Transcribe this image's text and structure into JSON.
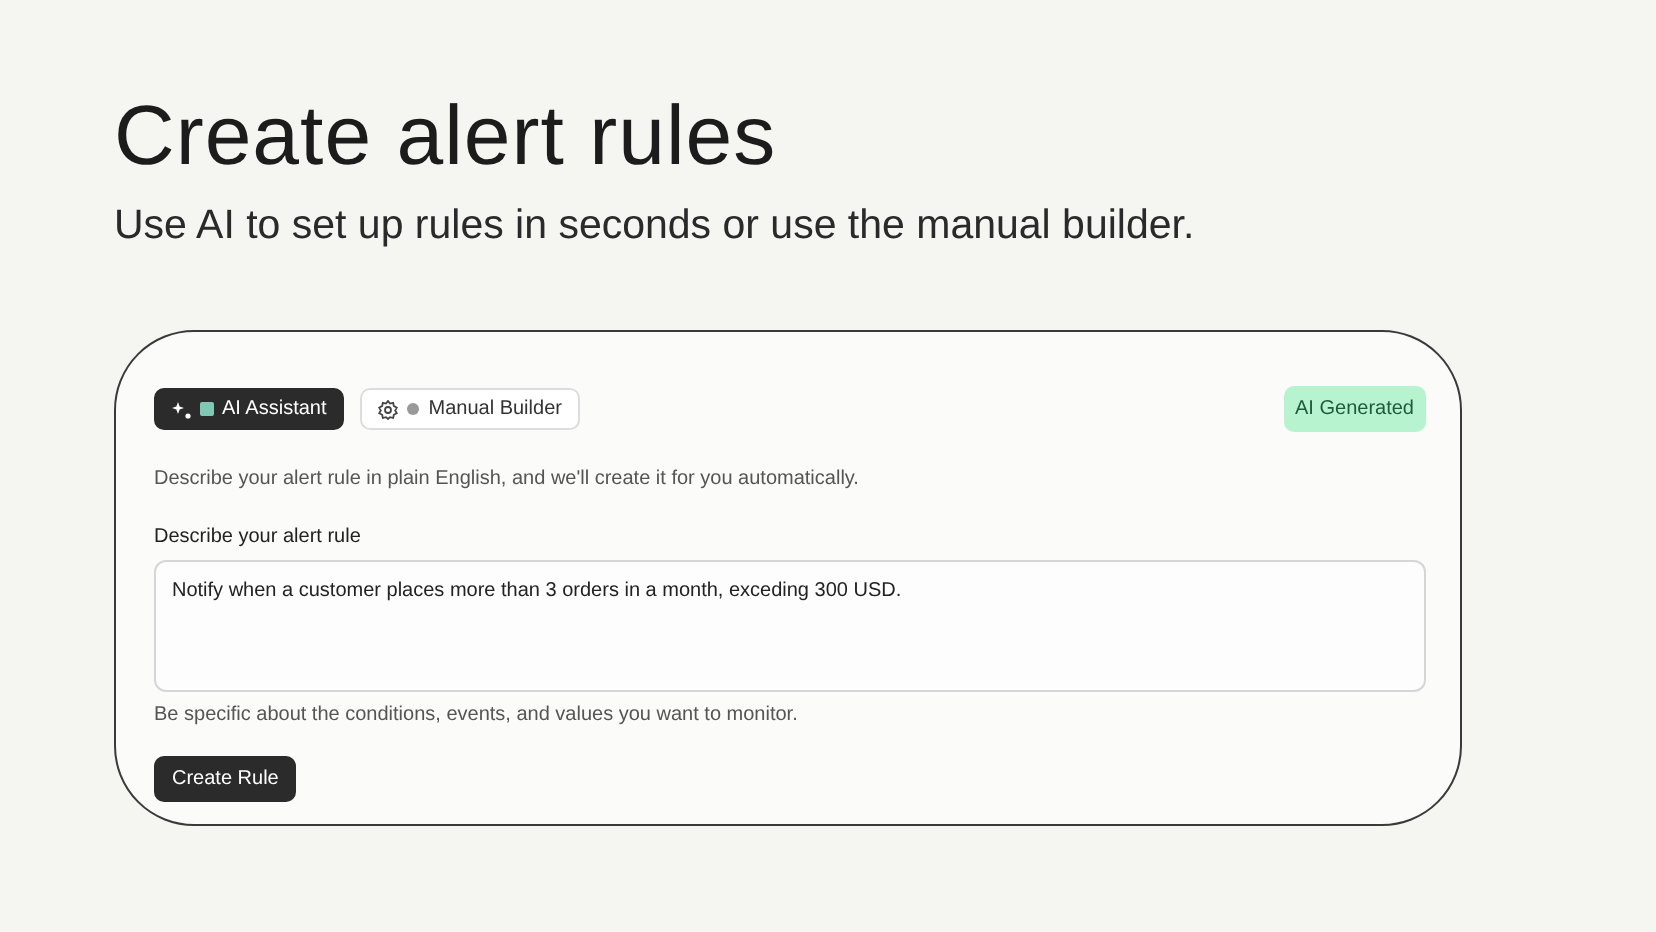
{
  "heading": "Create alert rules",
  "subheading": "Use AI to set up rules in seconds or use the manual builder.",
  "tabs": [
    {
      "label": "AI Assistant",
      "selected": true,
      "kind": "ai"
    },
    {
      "label": "Manual Builder",
      "selected": false,
      "kind": "manual"
    }
  ],
  "badge": "AI Generated",
  "intro": "Describe your alert rule in plain English, and we'll create it for you automatically.",
  "field": {
    "label": "Describe your alert rule",
    "value": "Notify when a customer places more than 3 orders in a month, exceding 300 USD.",
    "hint": "Be specific about the conditions, events, and values you want to monitor."
  },
  "button": "Create Rule"
}
